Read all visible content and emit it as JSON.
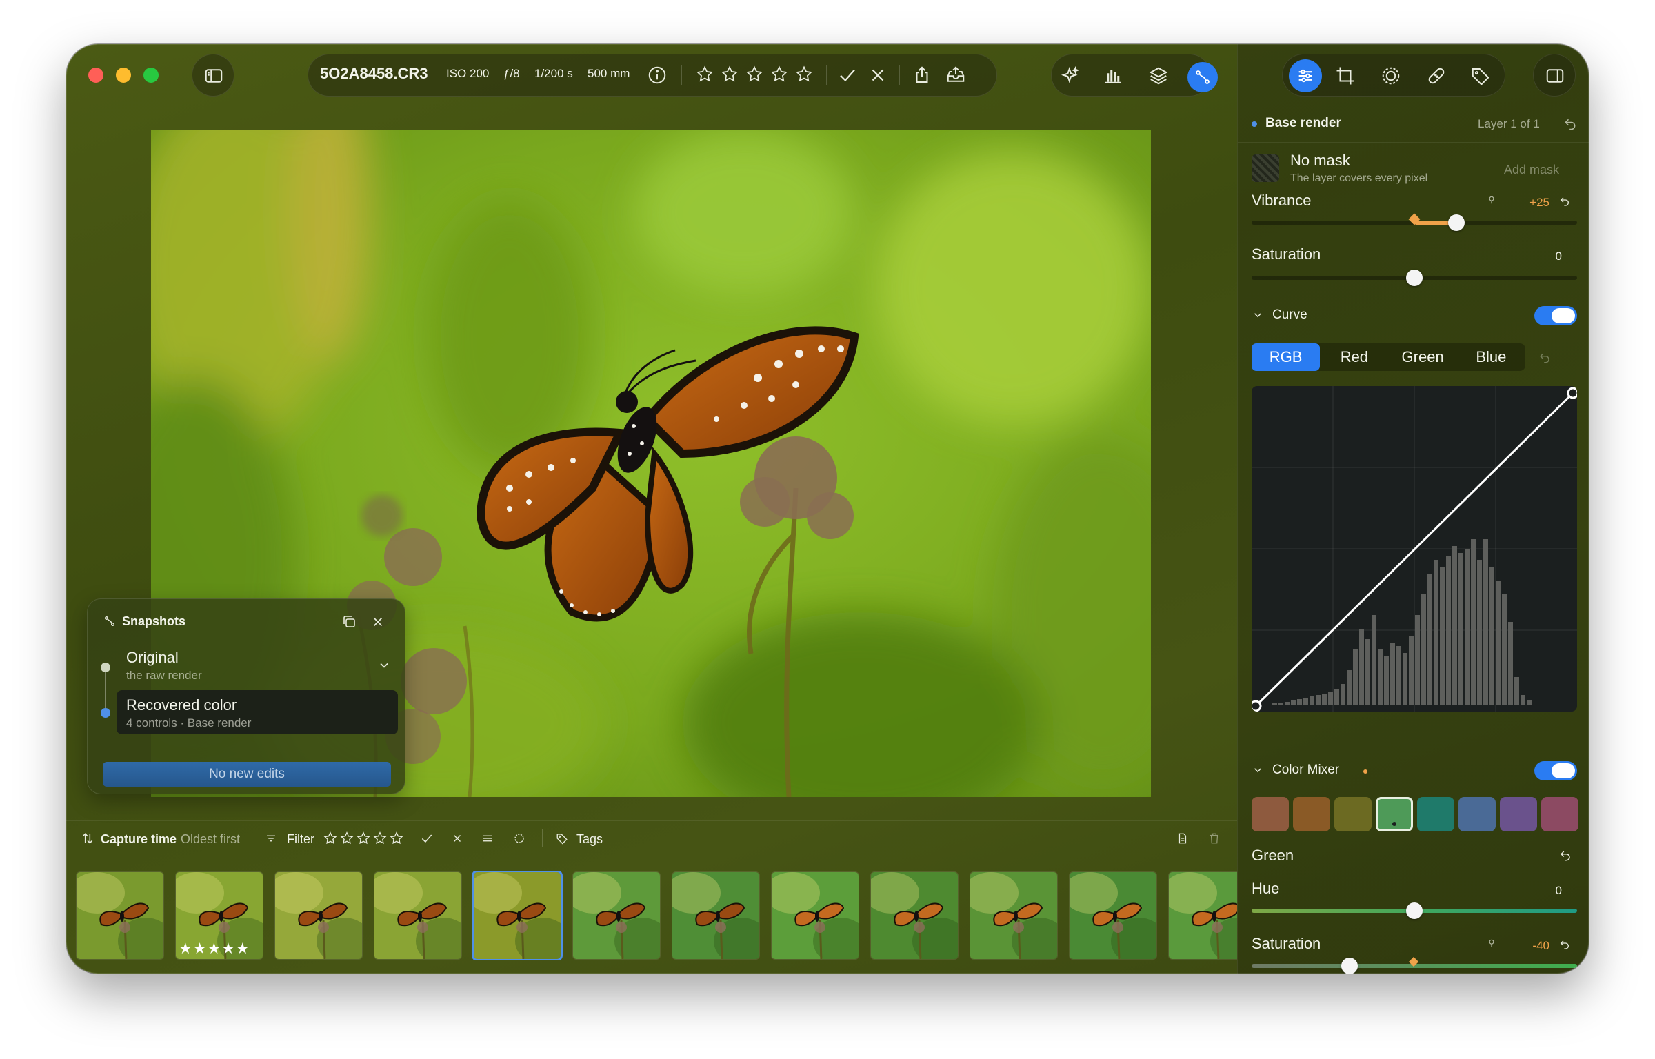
{
  "toolbar": {
    "filename": "5O2A8458.CR3",
    "iso": "ISO 200",
    "aperture": "ƒ/8",
    "shutter": "1/200 s",
    "focal": "500 mm",
    "rating_stars": 5
  },
  "snapshots": {
    "title": "Snapshots",
    "items": [
      {
        "title": "Original",
        "subtitle": "the raw render"
      },
      {
        "title": "Recovered color",
        "subtitle": "4 controls · Base render"
      }
    ],
    "button": "No new edits"
  },
  "filmstrip_bar": {
    "sort_label": "Capture time",
    "sort_order": "Oldest first",
    "filter_label": "Filter",
    "tags_label": "Tags"
  },
  "filmstrip": {
    "selected_index": 4,
    "rated_index": 1,
    "rated_stars": "★★★★★"
  },
  "inspector": {
    "layer_name": "Base render",
    "layer_count": "Layer 1 of 1",
    "mask_title": "No mask",
    "mask_subtitle": "The layer covers every pixel",
    "add_mask": "Add mask",
    "vibrance": {
      "label": "Vibrance",
      "value": "+25",
      "level": 0.63
    },
    "saturation": {
      "label": "Saturation",
      "value": "0",
      "level": 0.5
    },
    "curve": {
      "section": "Curve",
      "enabled": true,
      "channels": [
        "RGB",
        "Red",
        "Green",
        "Blue"
      ],
      "active_channel": "RGB"
    },
    "color_mixer": {
      "section": "Color Mixer",
      "enabled": true,
      "swatches": [
        "#8e5a3e",
        "#8a5a26",
        "#6c6a22",
        "#4e9a58",
        "#1f7a6a",
        "#4a6a96",
        "#6a528c",
        "#8c4a62"
      ],
      "selected_swatch": 3,
      "selected_name": "Green",
      "hue": {
        "label": "Hue",
        "value": "0",
        "level": 0.5
      },
      "saturation": {
        "label": "Saturation",
        "value": "-40",
        "level": 0.3
      }
    }
  },
  "colors": {
    "accent": "#2a7cf2",
    "vibrance_fill": "#f0a24a"
  }
}
